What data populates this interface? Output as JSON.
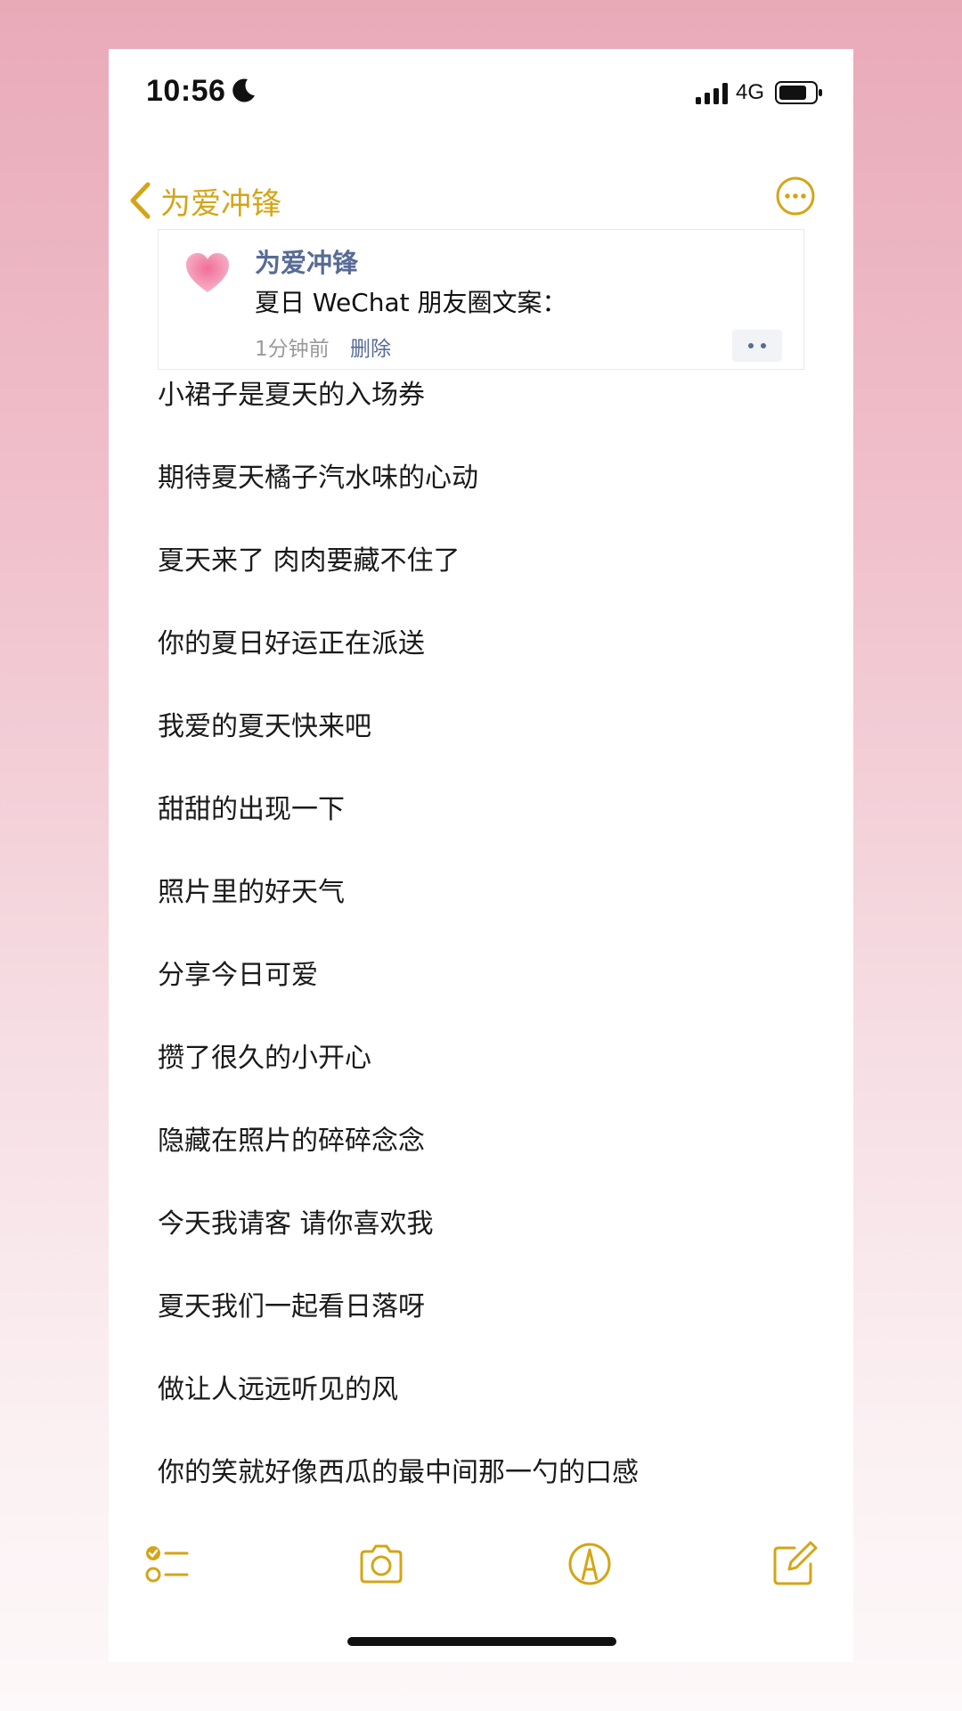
{
  "status_bar": {
    "time": "10:56",
    "network": "4G"
  },
  "nav": {
    "back_label": "为爱冲锋",
    "accent_color": "#d4a517"
  },
  "card": {
    "author": "为爱冲锋",
    "text": "夏日 WeChat 朋友圈文案：",
    "time": "1分钟前",
    "delete_label": "删除",
    "link_color": "#576b95"
  },
  "lines": [
    "小裙子是夏天的入场券",
    "期待夏天橘子汽水味的心动",
    "夏天来了 肉肉要藏不住了",
    "你的夏日好运正在派送",
    "我爱的夏天快来吧",
    "甜甜的出现一下",
    "照片里的好天气",
    "分享今日可爱",
    "攒了很久的小开心",
    "隐藏在照片的碎碎念念",
    "今天我请客 请你喜欢我",
    "夏天我们一起看日落呀",
    "做让人远远听见的风",
    "你的笑就好像西瓜的最中间那一勺的口感"
  ],
  "toolbar": {
    "icons": [
      "checklist-icon",
      "camera-icon",
      "markup-icon",
      "compose-icon"
    ]
  }
}
